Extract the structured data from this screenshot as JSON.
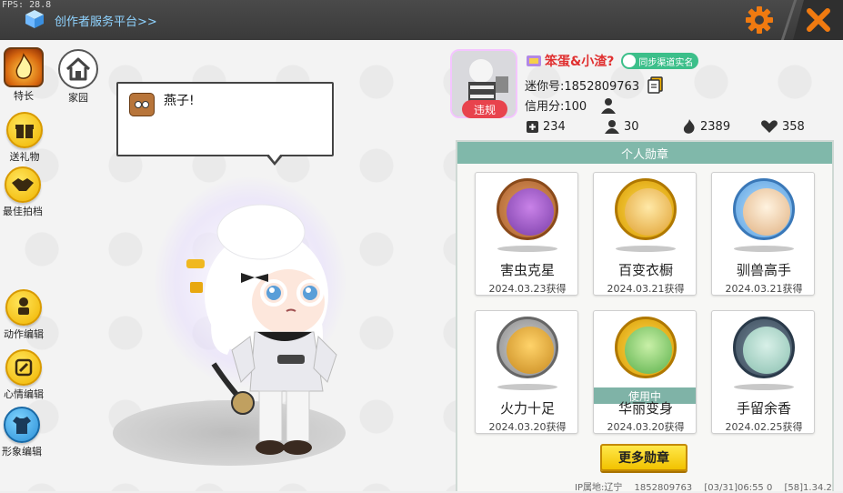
{
  "topbar": {
    "fps": "FPS: 28.8",
    "creator_link": "创作者服务平台>>"
  },
  "sidebar": {
    "talent": "特长",
    "home": "家园",
    "gift": "送礼物",
    "partner": "最佳拍档",
    "action_edit": "动作编辑",
    "mood_edit": "心情编辑",
    "look_edit": "形象编辑"
  },
  "bubble": {
    "text": "燕子!"
  },
  "profile": {
    "nickname": "笨蛋&小渣?",
    "sync_label": "同步渠道实名",
    "mini_id": "迷你号:1852809763",
    "credit": "信用分:100",
    "violation": "违规",
    "stats": {
      "posts": "234",
      "fans": "30",
      "heat": "2389",
      "likes": "358"
    }
  },
  "badges": {
    "title": "个人勋章",
    "items": [
      {
        "name": "害虫克星",
        "date": "2024.03.23获得",
        "in_use": false
      },
      {
        "name": "百变衣橱",
        "date": "2024.03.21获得",
        "in_use": false
      },
      {
        "name": "驯兽高手",
        "date": "2024.03.21获得",
        "in_use": false
      },
      {
        "name": "火力十足",
        "date": "2024.03.20获得",
        "in_use": false
      },
      {
        "name": "华丽变身",
        "date": "2024.03.20获得",
        "in_use": true
      },
      {
        "name": "手留余香",
        "date": "2024.02.25获得",
        "in_use": false
      }
    ],
    "in_use_label": "使用中",
    "more_button": "更多勋章"
  },
  "footer": {
    "ip": "IP属地:辽宁",
    "uid": "1852809763",
    "time": "[03/31]06:55 0",
    "version": "[58]1.34.2"
  },
  "colors": {
    "accent_orange": "#f07a10",
    "panel_teal": "#80b8aa",
    "nickname_red": "#e03030",
    "violation_red": "#e8434d",
    "more_button_yellow": "#f2c200"
  }
}
